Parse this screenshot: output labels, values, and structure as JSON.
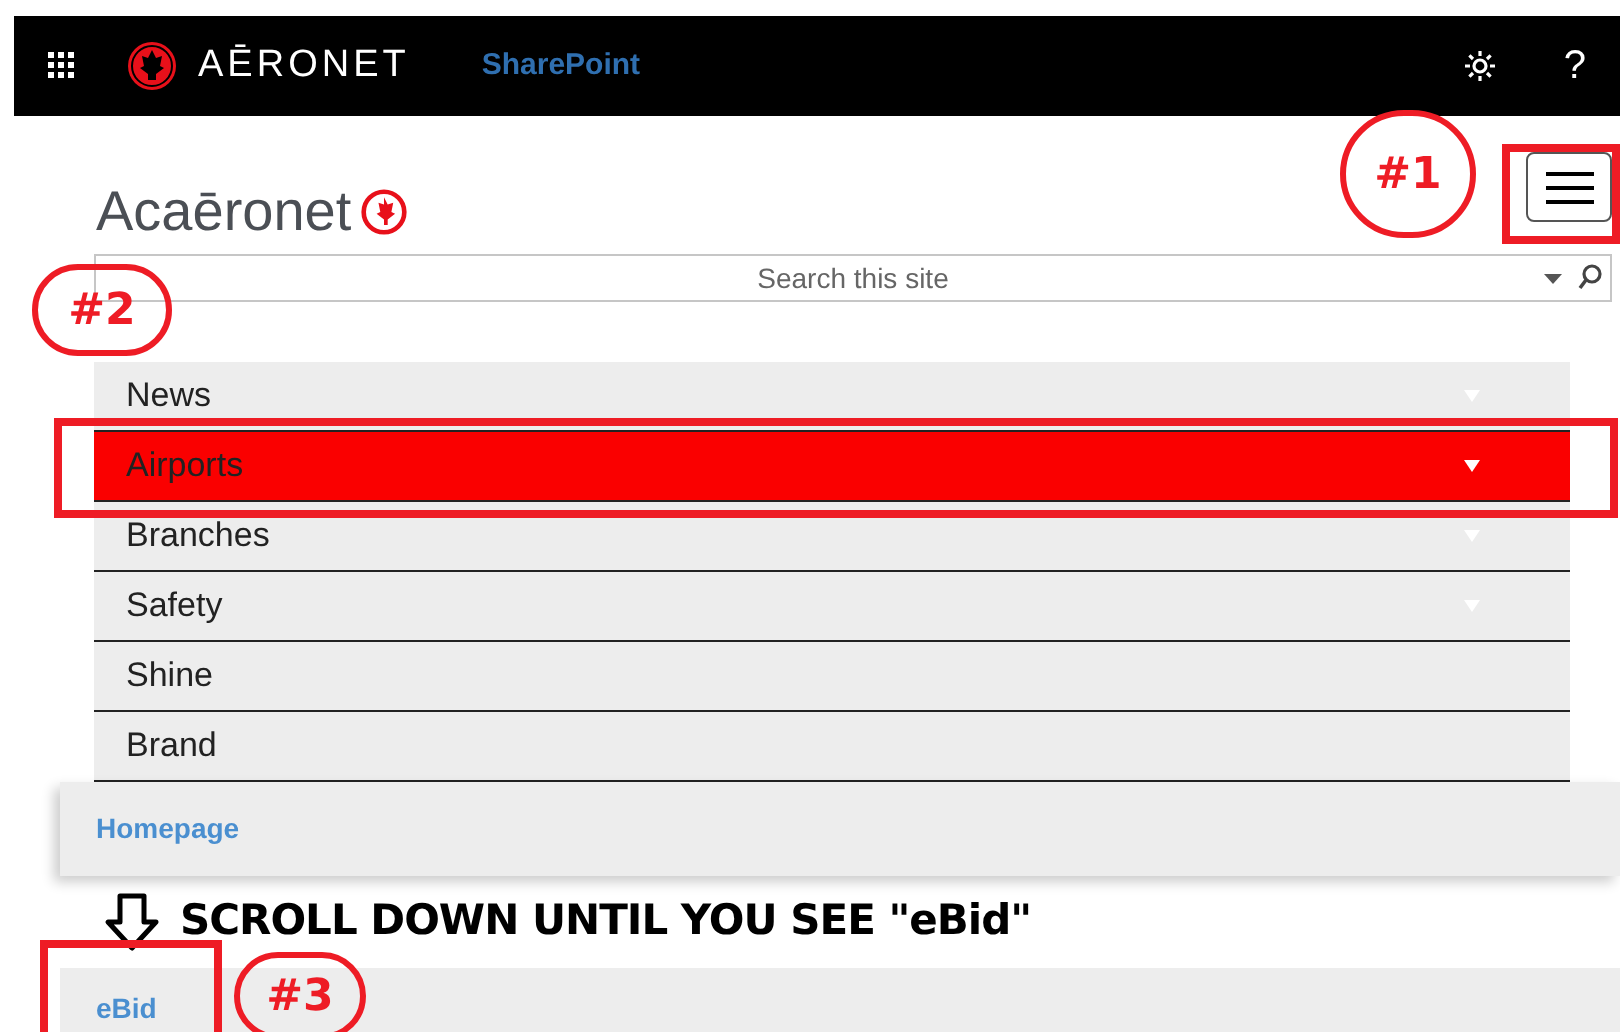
{
  "top_bar": {
    "brand": "AĒRONET",
    "app": "SharePoint",
    "help": "?"
  },
  "site": {
    "logo": "Acaēronet"
  },
  "search": {
    "placeholder": "Search this site"
  },
  "nav": [
    {
      "label": "News",
      "selected": false,
      "expandable": true
    },
    {
      "label": "Airports",
      "selected": true,
      "expandable": true
    },
    {
      "label": "Branches",
      "selected": false,
      "expandable": true
    },
    {
      "label": "Safety",
      "selected": false,
      "expandable": true
    },
    {
      "label": "Shine",
      "selected": false,
      "expandable": false
    },
    {
      "label": "Brand",
      "selected": false,
      "expandable": false
    }
  ],
  "panel_link": "Homepage",
  "instruction": "SCROLL DOWN UNTIL YOU SEE \"eBid\"",
  "panel_link_2": "eBid",
  "annotations": [
    {
      "label": "#1"
    },
    {
      "label": "#2"
    },
    {
      "label": "#3"
    }
  ]
}
